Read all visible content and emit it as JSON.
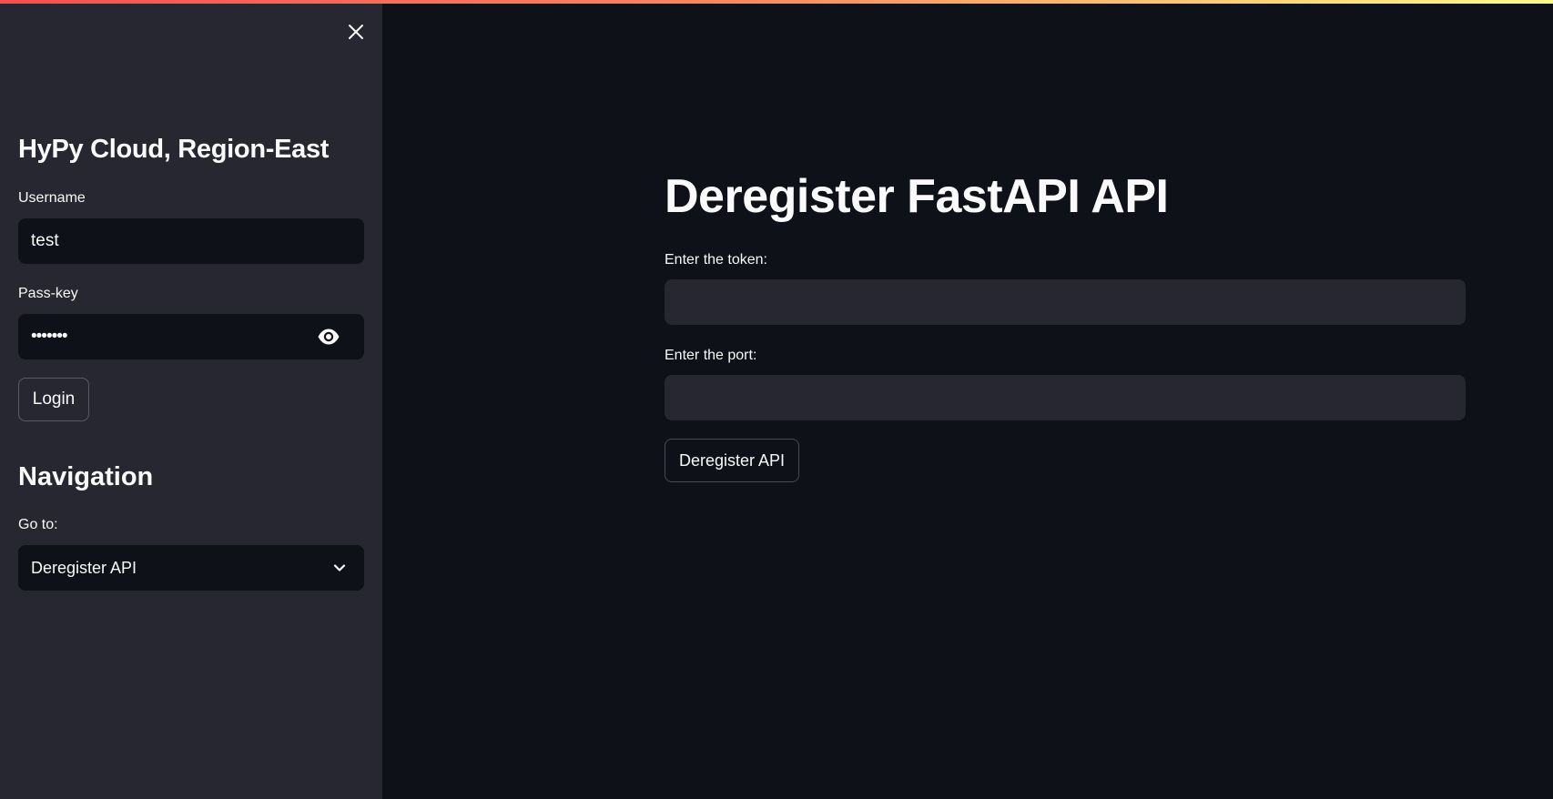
{
  "sidebar": {
    "close_icon": "close-icon",
    "title": "HyPy Cloud, Region-East",
    "username": {
      "label": "Username",
      "value": "test"
    },
    "passkey": {
      "label": "Pass-key",
      "value": "•••••••",
      "toggle_icon": "eye-icon"
    },
    "login_label": "Login",
    "navigation": {
      "title": "Navigation",
      "goto_label": "Go to:",
      "selected": "Deregister API",
      "dropdown_icon": "chevron-down-icon"
    }
  },
  "main": {
    "title": "Deregister FastAPI API",
    "token": {
      "label": "Enter the token:",
      "value": ""
    },
    "port": {
      "label": "Enter the port:",
      "value": ""
    },
    "submit_label": "Deregister API"
  },
  "colors": {
    "main_bg": "#0e1117",
    "sidebar_bg": "#262730",
    "text": "#fafafa",
    "accent_gradient_start": "#ff4b4b",
    "accent_gradient_end": "#fffd80"
  }
}
